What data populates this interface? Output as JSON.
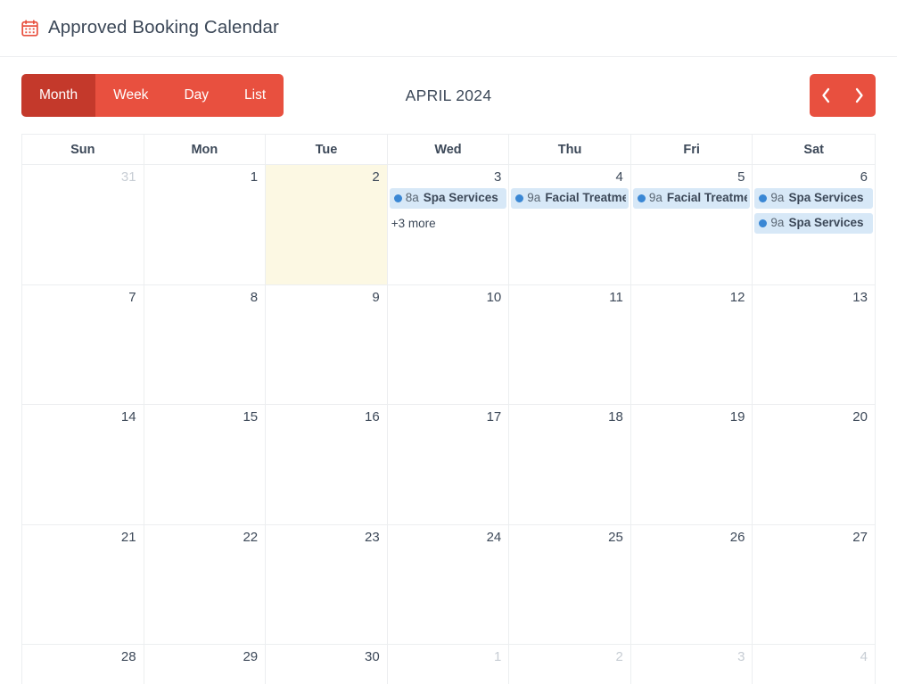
{
  "header": {
    "icon": "calendar-icon",
    "icon_color": "#e8503f",
    "title": "Approved Booking Calendar"
  },
  "toolbar": {
    "views": [
      {
        "label": "Month",
        "active": true
      },
      {
        "label": "Week",
        "active": false
      },
      {
        "label": "Day",
        "active": false
      },
      {
        "label": "List",
        "active": false
      }
    ],
    "title": "APRIL 2024",
    "prev_label": "‹",
    "next_label": "›",
    "active_color": "#c4392b",
    "button_color": "#e8503f"
  },
  "calendar": {
    "day_headers": [
      "Sun",
      "Mon",
      "Tue",
      "Wed",
      "Thu",
      "Fri",
      "Sat"
    ],
    "today_column_index": 2,
    "today_bg": "#fcf8e3",
    "event_bg": "#d7e8f7",
    "event_dot_color": "#3a87d4",
    "weeks": [
      {
        "days": [
          {
            "num": "31",
            "other_month": true,
            "today": false,
            "events": [],
            "more": ""
          },
          {
            "num": "1",
            "other_month": false,
            "today": false,
            "events": [],
            "more": ""
          },
          {
            "num": "2",
            "other_month": false,
            "today": true,
            "events": [],
            "more": ""
          },
          {
            "num": "3",
            "other_month": false,
            "today": false,
            "events": [
              {
                "time": "8a",
                "title": "Spa Services"
              }
            ],
            "more": "+3 more"
          },
          {
            "num": "4",
            "other_month": false,
            "today": false,
            "events": [
              {
                "time": "9a",
                "title": "Facial Treatment"
              }
            ],
            "more": ""
          },
          {
            "num": "5",
            "other_month": false,
            "today": false,
            "events": [
              {
                "time": "9a",
                "title": "Facial Treatment"
              }
            ],
            "more": ""
          },
          {
            "num": "6",
            "other_month": false,
            "today": false,
            "events": [
              {
                "time": "9a",
                "title": "Spa Services"
              },
              {
                "time": "9a",
                "title": "Spa Services"
              }
            ],
            "more": ""
          }
        ]
      },
      {
        "days": [
          {
            "num": "7",
            "other_month": false,
            "today": false,
            "events": [],
            "more": ""
          },
          {
            "num": "8",
            "other_month": false,
            "today": false,
            "events": [],
            "more": ""
          },
          {
            "num": "9",
            "other_month": false,
            "today": false,
            "events": [],
            "more": ""
          },
          {
            "num": "10",
            "other_month": false,
            "today": false,
            "events": [],
            "more": ""
          },
          {
            "num": "11",
            "other_month": false,
            "today": false,
            "events": [],
            "more": ""
          },
          {
            "num": "12",
            "other_month": false,
            "today": false,
            "events": [],
            "more": ""
          },
          {
            "num": "13",
            "other_month": false,
            "today": false,
            "events": [],
            "more": ""
          }
        ]
      },
      {
        "days": [
          {
            "num": "14",
            "other_month": false,
            "today": false,
            "events": [],
            "more": ""
          },
          {
            "num": "15",
            "other_month": false,
            "today": false,
            "events": [],
            "more": ""
          },
          {
            "num": "16",
            "other_month": false,
            "today": false,
            "events": [],
            "more": ""
          },
          {
            "num": "17",
            "other_month": false,
            "today": false,
            "events": [],
            "more": ""
          },
          {
            "num": "18",
            "other_month": false,
            "today": false,
            "events": [],
            "more": ""
          },
          {
            "num": "19",
            "other_month": false,
            "today": false,
            "events": [],
            "more": ""
          },
          {
            "num": "20",
            "other_month": false,
            "today": false,
            "events": [],
            "more": ""
          }
        ]
      },
      {
        "days": [
          {
            "num": "21",
            "other_month": false,
            "today": false,
            "events": [],
            "more": ""
          },
          {
            "num": "22",
            "other_month": false,
            "today": false,
            "events": [],
            "more": ""
          },
          {
            "num": "23",
            "other_month": false,
            "today": false,
            "events": [],
            "more": ""
          },
          {
            "num": "24",
            "other_month": false,
            "today": false,
            "events": [],
            "more": ""
          },
          {
            "num": "25",
            "other_month": false,
            "today": false,
            "events": [],
            "more": ""
          },
          {
            "num": "26",
            "other_month": false,
            "today": false,
            "events": [],
            "more": ""
          },
          {
            "num": "27",
            "other_month": false,
            "today": false,
            "events": [],
            "more": ""
          }
        ]
      },
      {
        "days": [
          {
            "num": "28",
            "other_month": false,
            "today": false,
            "events": [],
            "more": ""
          },
          {
            "num": "29",
            "other_month": false,
            "today": false,
            "events": [],
            "more": ""
          },
          {
            "num": "30",
            "other_month": false,
            "today": false,
            "events": [],
            "more": ""
          },
          {
            "num": "1",
            "other_month": true,
            "today": false,
            "events": [],
            "more": ""
          },
          {
            "num": "2",
            "other_month": true,
            "today": false,
            "events": [],
            "more": ""
          },
          {
            "num": "3",
            "other_month": true,
            "today": false,
            "events": [],
            "more": ""
          },
          {
            "num": "4",
            "other_month": true,
            "today": false,
            "events": [],
            "more": ""
          }
        ]
      }
    ]
  }
}
